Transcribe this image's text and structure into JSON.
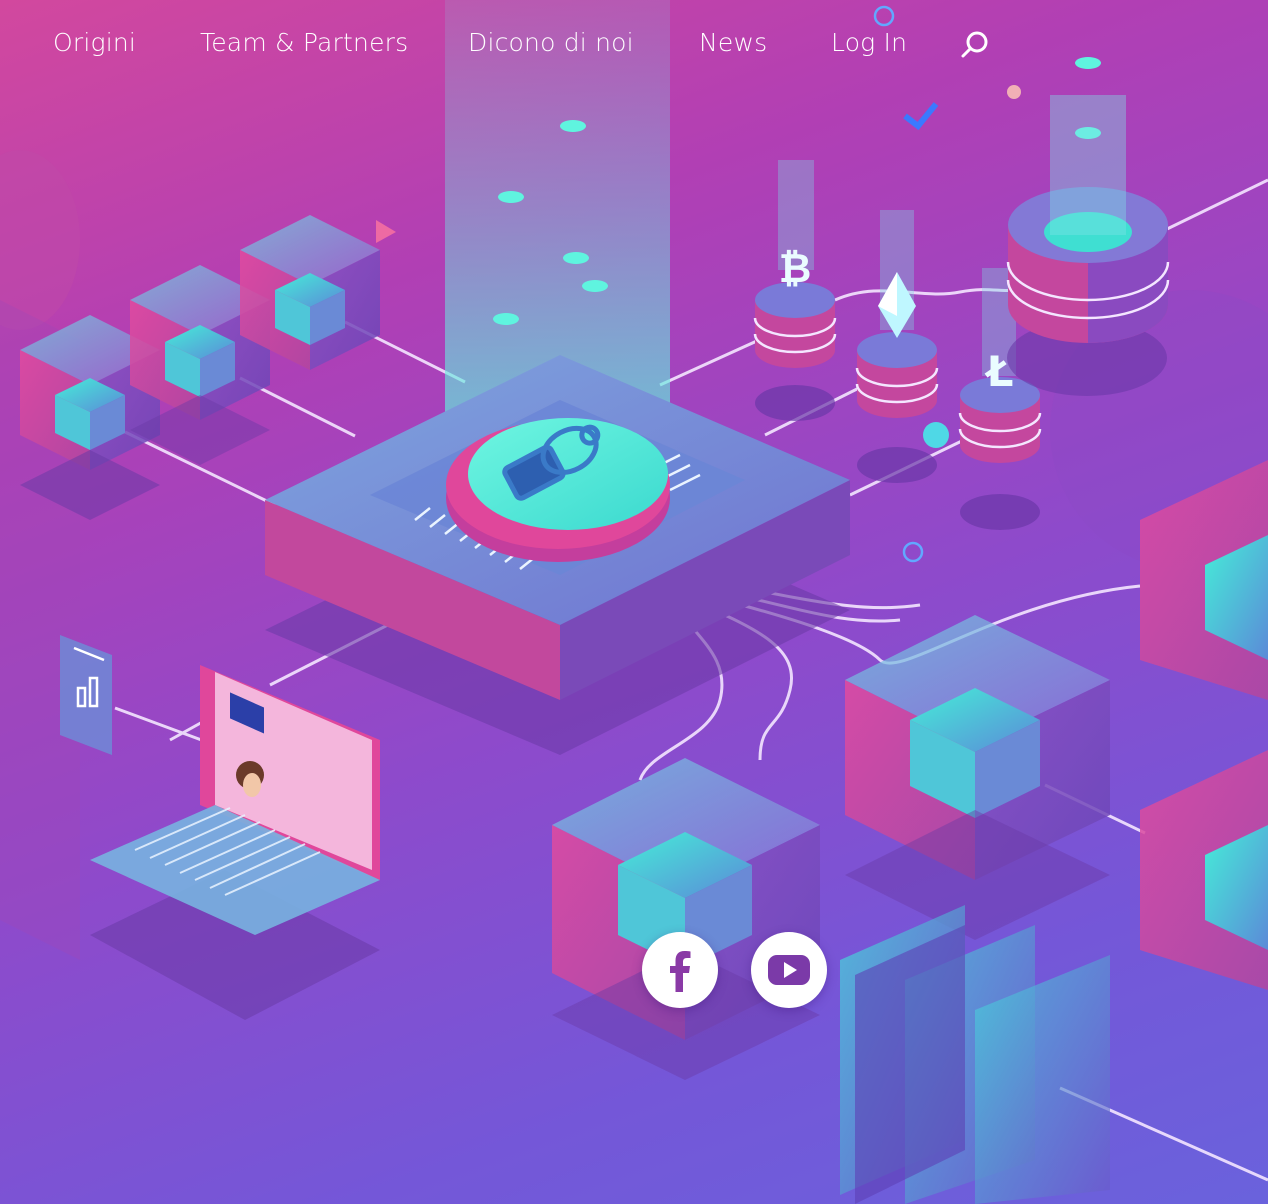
{
  "nav": {
    "items": [
      {
        "label": "Origini"
      },
      {
        "label": "Team & Partners"
      },
      {
        "label": "Dicono di noi"
      },
      {
        "label": "News"
      },
      {
        "label": "Log In"
      }
    ],
    "search_icon": "search-icon"
  },
  "social": {
    "facebook_icon": "facebook-icon",
    "youtube_icon": "youtube-icon"
  },
  "colors": {
    "background_top": "#d2489e",
    "background_bottom": "#6a62dc",
    "accent_cyan": "#4ef0d6",
    "accent_pink": "#e0479b"
  }
}
